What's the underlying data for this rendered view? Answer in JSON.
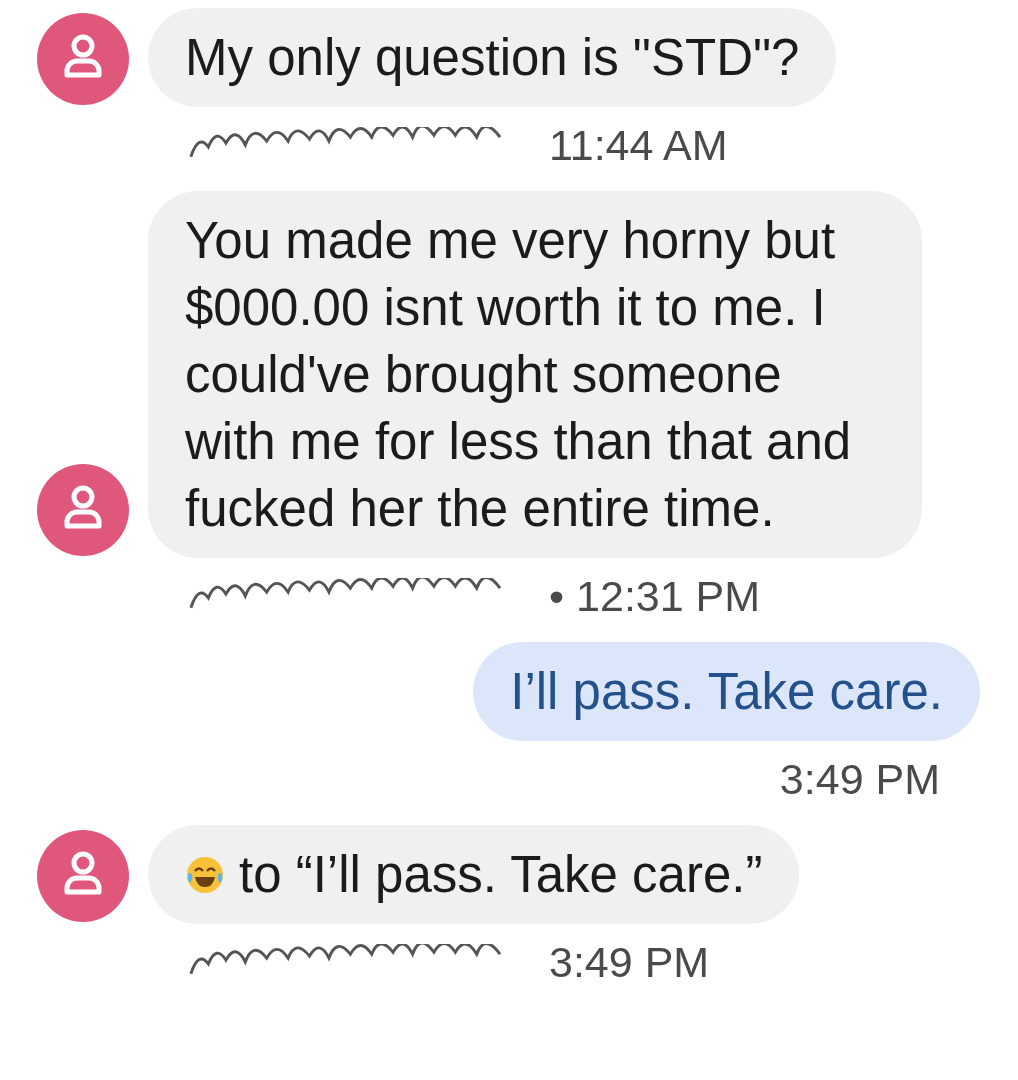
{
  "messages": [
    {
      "kind": "incoming",
      "text": "My only question is \"STD\"?",
      "sender_redacted": true,
      "time": "11:44 AM"
    },
    {
      "kind": "incoming",
      "text": "You made me very horny but $000.00 isnt worth it to me. I could've brought someone with me for less than that and fucked her the entire time.",
      "sender_redacted": true,
      "bullet": "•",
      "time": "12:31 PM"
    },
    {
      "kind": "outgoing",
      "text": "I’ll pass. Take care.",
      "time": "3:49 PM"
    },
    {
      "kind": "reaction",
      "text": "to “I’ll pass. Take care.”",
      "sender_redacted": true,
      "time": "3:49 PM"
    }
  ]
}
